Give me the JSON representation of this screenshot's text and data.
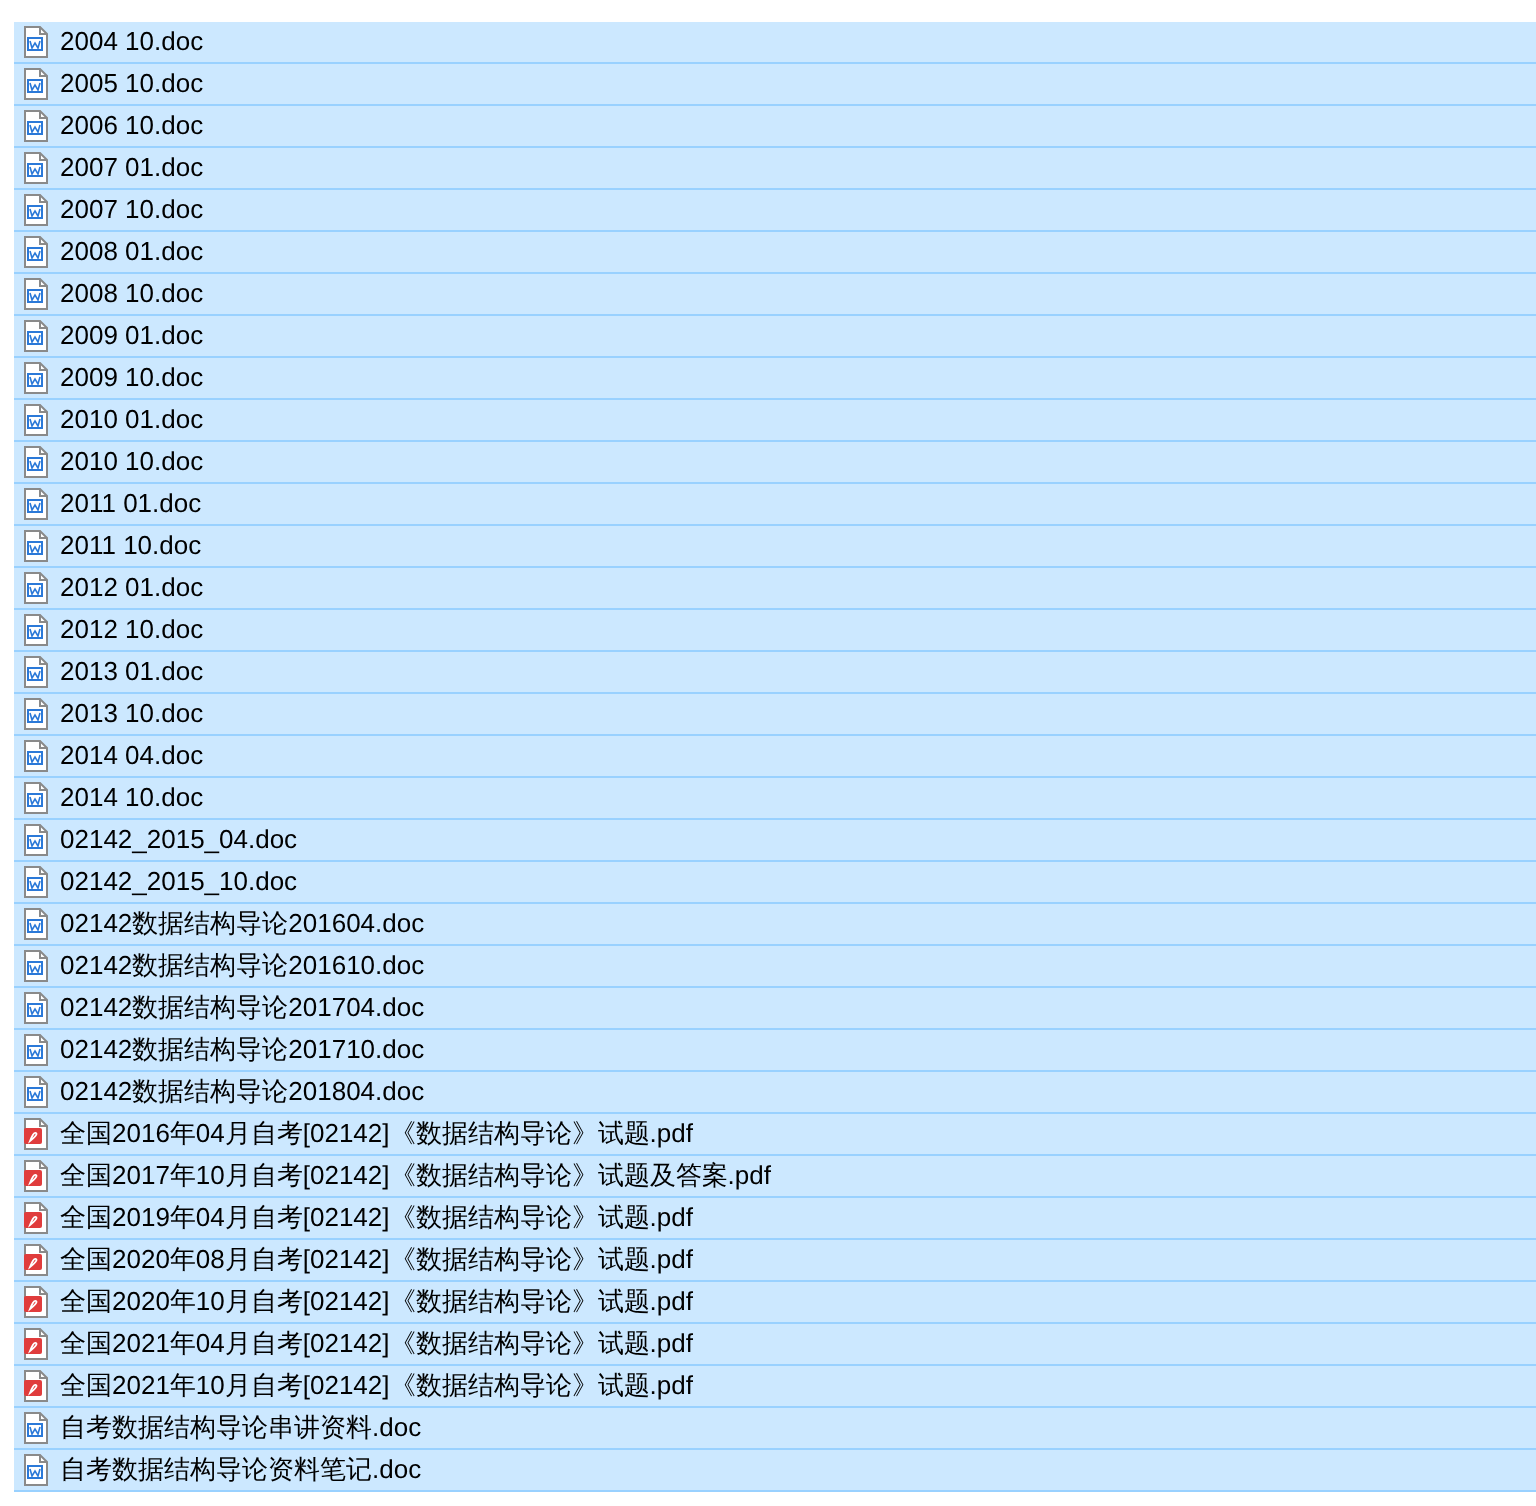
{
  "files": [
    {
      "name": "2004 10.doc",
      "kind": "doc",
      "selected": true
    },
    {
      "name": "2005 10.doc",
      "kind": "doc",
      "selected": true
    },
    {
      "name": "2006 10.doc",
      "kind": "doc",
      "selected": true
    },
    {
      "name": "2007 01.doc",
      "kind": "doc",
      "selected": true
    },
    {
      "name": "2007 10.doc",
      "kind": "doc",
      "selected": true
    },
    {
      "name": "2008 01.doc",
      "kind": "doc",
      "selected": true
    },
    {
      "name": "2008 10.doc",
      "kind": "doc",
      "selected": true
    },
    {
      "name": "2009 01.doc",
      "kind": "doc",
      "selected": true
    },
    {
      "name": "2009 10.doc",
      "kind": "doc",
      "selected": true
    },
    {
      "name": "2010 01.doc",
      "kind": "doc",
      "selected": true
    },
    {
      "name": "2010 10.doc",
      "kind": "doc",
      "selected": true
    },
    {
      "name": "2011 01.doc",
      "kind": "doc",
      "selected": true
    },
    {
      "name": "2011 10.doc",
      "kind": "doc",
      "selected": true
    },
    {
      "name": "2012 01.doc",
      "kind": "doc",
      "selected": true
    },
    {
      "name": "2012 10.doc",
      "kind": "doc",
      "selected": true
    },
    {
      "name": "2013 01.doc",
      "kind": "doc",
      "selected": true
    },
    {
      "name": "2013 10.doc",
      "kind": "doc",
      "selected": true
    },
    {
      "name": "2014 04.doc",
      "kind": "doc",
      "selected": true
    },
    {
      "name": "2014 10.doc",
      "kind": "doc",
      "selected": true
    },
    {
      "name": "02142_2015_04.doc",
      "kind": "doc",
      "selected": true
    },
    {
      "name": "02142_2015_10.doc",
      "kind": "doc",
      "selected": true
    },
    {
      "name": "02142数据结构导论201604.doc",
      "kind": "doc",
      "selected": true
    },
    {
      "name": "02142数据结构导论201610.doc",
      "kind": "doc",
      "selected": true
    },
    {
      "name": "02142数据结构导论201704.doc",
      "kind": "doc",
      "selected": true
    },
    {
      "name": "02142数据结构导论201710.doc",
      "kind": "doc",
      "selected": true
    },
    {
      "name": "02142数据结构导论201804.doc",
      "kind": "doc",
      "selected": true
    },
    {
      "name": "全国2016年04月自考[02142]《数据结构导论》试题.pdf",
      "kind": "pdf",
      "selected": true
    },
    {
      "name": "全国2017年10月自考[02142]《数据结构导论》试题及答案.pdf",
      "kind": "pdf",
      "selected": true
    },
    {
      "name": "全国2019年04月自考[02142]《数据结构导论》试题.pdf",
      "kind": "pdf",
      "selected": true
    },
    {
      "name": "全国2020年08月自考[02142]《数据结构导论》试题.pdf",
      "kind": "pdf",
      "selected": true
    },
    {
      "name": "全国2020年10月自考[02142]《数据结构导论》试题.pdf",
      "kind": "pdf",
      "selected": true
    },
    {
      "name": "全国2021年04月自考[02142]《数据结构导论》试题.pdf",
      "kind": "pdf",
      "selected": true
    },
    {
      "name": "全国2021年10月自考[02142]《数据结构导论》试题.pdf",
      "kind": "pdf",
      "selected": true
    },
    {
      "name": "自考数据结构导论串讲资料.doc",
      "kind": "doc",
      "selected": true
    },
    {
      "name": "自考数据结构导论资料笔记.doc",
      "kind": "doc",
      "selected": true
    }
  ]
}
